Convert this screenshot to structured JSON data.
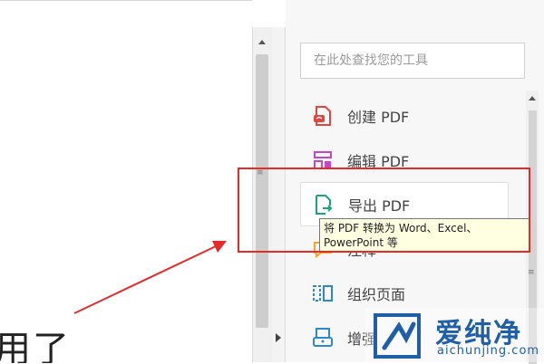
{
  "document": {
    "visible_text": "用了"
  },
  "tools_pane": {
    "search_placeholder": "在此处查找您的工具",
    "tools": [
      {
        "label": "创建 PDF",
        "icon": "create-pdf-icon",
        "color": "#e0463f"
      },
      {
        "label": "编辑 PDF",
        "icon": "edit-pdf-icon",
        "color": "#c546c7"
      },
      {
        "label": "导出 PDF",
        "icon": "export-pdf-icon",
        "color": "#1ea27a"
      },
      {
        "label": "注释",
        "icon": "comment-icon",
        "color": "#f5a623"
      },
      {
        "label": "组织页面",
        "icon": "organize-pages-icon",
        "color": "#2d89c8"
      },
      {
        "label": "增强",
        "icon": "enhance-scan-icon",
        "color": "#2d89c8"
      }
    ],
    "tooltip": "将 PDF 转换为 Word、Excel、PowerPoint 等"
  },
  "annotation": {
    "highlight_color": "#e52a2a"
  },
  "watermark": {
    "title": "爱纯净",
    "url": "aichunjing.com",
    "color": "#1f5fa8"
  }
}
